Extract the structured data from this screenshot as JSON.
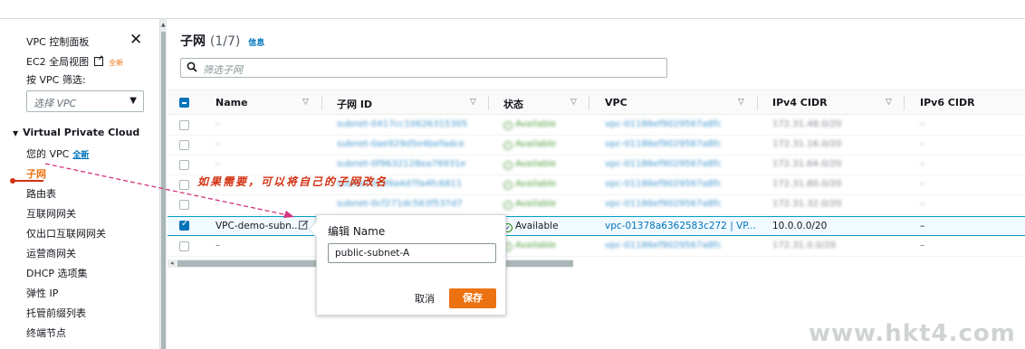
{
  "sidebar": {
    "vpc_dashboard": "VPC 控制面板",
    "ec2_global_view": "EC2 全局视图",
    "ec2_global_badge": "全新",
    "filter_by_vpc": "按 VPC 筛选:",
    "select_vpc_placeholder": "选择 VPC",
    "section": "Virtual Private Cloud",
    "items": [
      {
        "label": "您的 VPC",
        "badge": "全新"
      },
      {
        "label": "子网"
      },
      {
        "label": "路由表"
      },
      {
        "label": "互联网网关"
      },
      {
        "label": "仅出口互联网网关"
      },
      {
        "label": "运营商网关"
      },
      {
        "label": "DHCP 选项集"
      },
      {
        "label": "弹性 IP"
      },
      {
        "label": "托管前缀列表"
      },
      {
        "label": "终端节点"
      }
    ]
  },
  "main": {
    "title": "子网",
    "count": "(1/7)",
    "info": "信息",
    "filter_placeholder": "筛选子网",
    "columns": [
      "Name",
      "子网 ID",
      "状态",
      "VPC",
      "IPv4 CIDR",
      "IPv6 CIDR"
    ],
    "rows": [
      {
        "name": "–",
        "id": "subnet-0417cc10626315305",
        "status": "Available",
        "vpc": "vpc-01186ef9029567a8fc",
        "ipv4": "172.31.48.0/20",
        "ipv6": "–"
      },
      {
        "name": "–",
        "id": "subnet-0ae929d5e4befadce",
        "status": "Available",
        "vpc": "vpc-01186ef9029567a8fc",
        "ipv4": "172.31.16.0/20",
        "ipv6": "–"
      },
      {
        "name": "–",
        "id": "subnet-0f9632128ea76931e",
        "status": "Available",
        "vpc": "vpc-01186ef9029567a8fc",
        "ipv4": "172.31.64.0/20",
        "ipv6": "–"
      },
      {
        "name": "–",
        "id": "subnet-0c99a4d7fa4fc6811",
        "status": "Available",
        "vpc": "vpc-01186ef9029567a8fc",
        "ipv4": "172.31.80.0/20",
        "ipv6": "–"
      },
      {
        "name": "–",
        "id": "subnet-0cf271dc563f537d7",
        "status": "Available",
        "vpc": "vpc-01186ef9029567a8fc",
        "ipv4": "172.31.32.0/20",
        "ipv6": "–"
      },
      {
        "name": "VPC-demo-subn...",
        "id": "",
        "status": "Available",
        "vpc": "vpc-01378a6362583c272 | VP...",
        "ipv4": "10.0.0.0/20",
        "ipv6": "–"
      },
      {
        "name": "–",
        "id": "",
        "status": "Available",
        "vpc": "vpc-01186ef9029567a8fc",
        "ipv4": "172.31.0.0/20",
        "ipv6": "–"
      }
    ]
  },
  "popover": {
    "title": "编辑 Name",
    "value": "public-subnet-A",
    "cancel": "取消",
    "save": "保存"
  },
  "annotation": "如果需要，可以将自己的子网改名",
  "watermark": "www.hkt4.com",
  "colors": {
    "accent": "#ec7211",
    "link": "#0073bb",
    "ok": "#1d8102",
    "annotation": "#d13212"
  }
}
